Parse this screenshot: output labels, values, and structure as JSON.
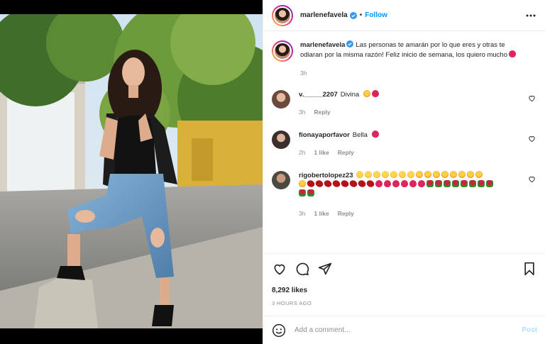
{
  "post": {
    "username": "marlenefavela",
    "follow_label": "Follow",
    "dot": "•"
  },
  "caption": {
    "username": "marlenefavela",
    "text": "Las personas te amarán por lo que eres y otras te odiaran por la misma razón! Feliz inicio de semana, los quiero mucho",
    "time": "3h"
  },
  "comments": [
    {
      "username": "v._____2207",
      "text": "Divina",
      "emojis": [
        "star",
        "red"
      ],
      "time": "3h",
      "likes": "",
      "reply": "Reply"
    },
    {
      "username": "fionayaporfavor",
      "text": "Bella",
      "emojis": [
        "red"
      ],
      "time": "2h",
      "likes": "1 like",
      "reply": "Reply"
    },
    {
      "username": "rigobertolopez23",
      "text": "",
      "emojis_line1": [
        "face",
        "face",
        "face",
        "face",
        "face",
        "face",
        "face",
        "star",
        "star",
        "star",
        "star",
        "star",
        "star",
        "star",
        "star"
      ],
      "emojis_line2": [
        "star",
        "lips",
        "lips",
        "lips",
        "lips",
        "lips",
        "lips",
        "lips",
        "lips",
        "red",
        "red",
        "red",
        "red",
        "red",
        "red",
        "rose",
        "rose",
        "rose",
        "rose",
        "rose",
        "rose",
        "rose",
        "rose"
      ],
      "emojis_line3": [
        "rose",
        "rose"
      ],
      "time": "3h",
      "likes": "1 like",
      "reply": "Reply"
    }
  ],
  "actions": {
    "likes": "8,292 likes",
    "time": "3 HOURS AGO"
  },
  "add_comment": {
    "placeholder": "Add a comment...",
    "post_label": "Post"
  },
  "colors": {
    "accent": "#0095f6",
    "post_disabled": "#b2dffc",
    "muted": "#8e8e8e"
  },
  "icons": [
    "verified-badge-icon",
    "more-options-icon",
    "heart-icon",
    "comment-icon",
    "share-icon",
    "bookmark-icon",
    "smiley-icon"
  ]
}
